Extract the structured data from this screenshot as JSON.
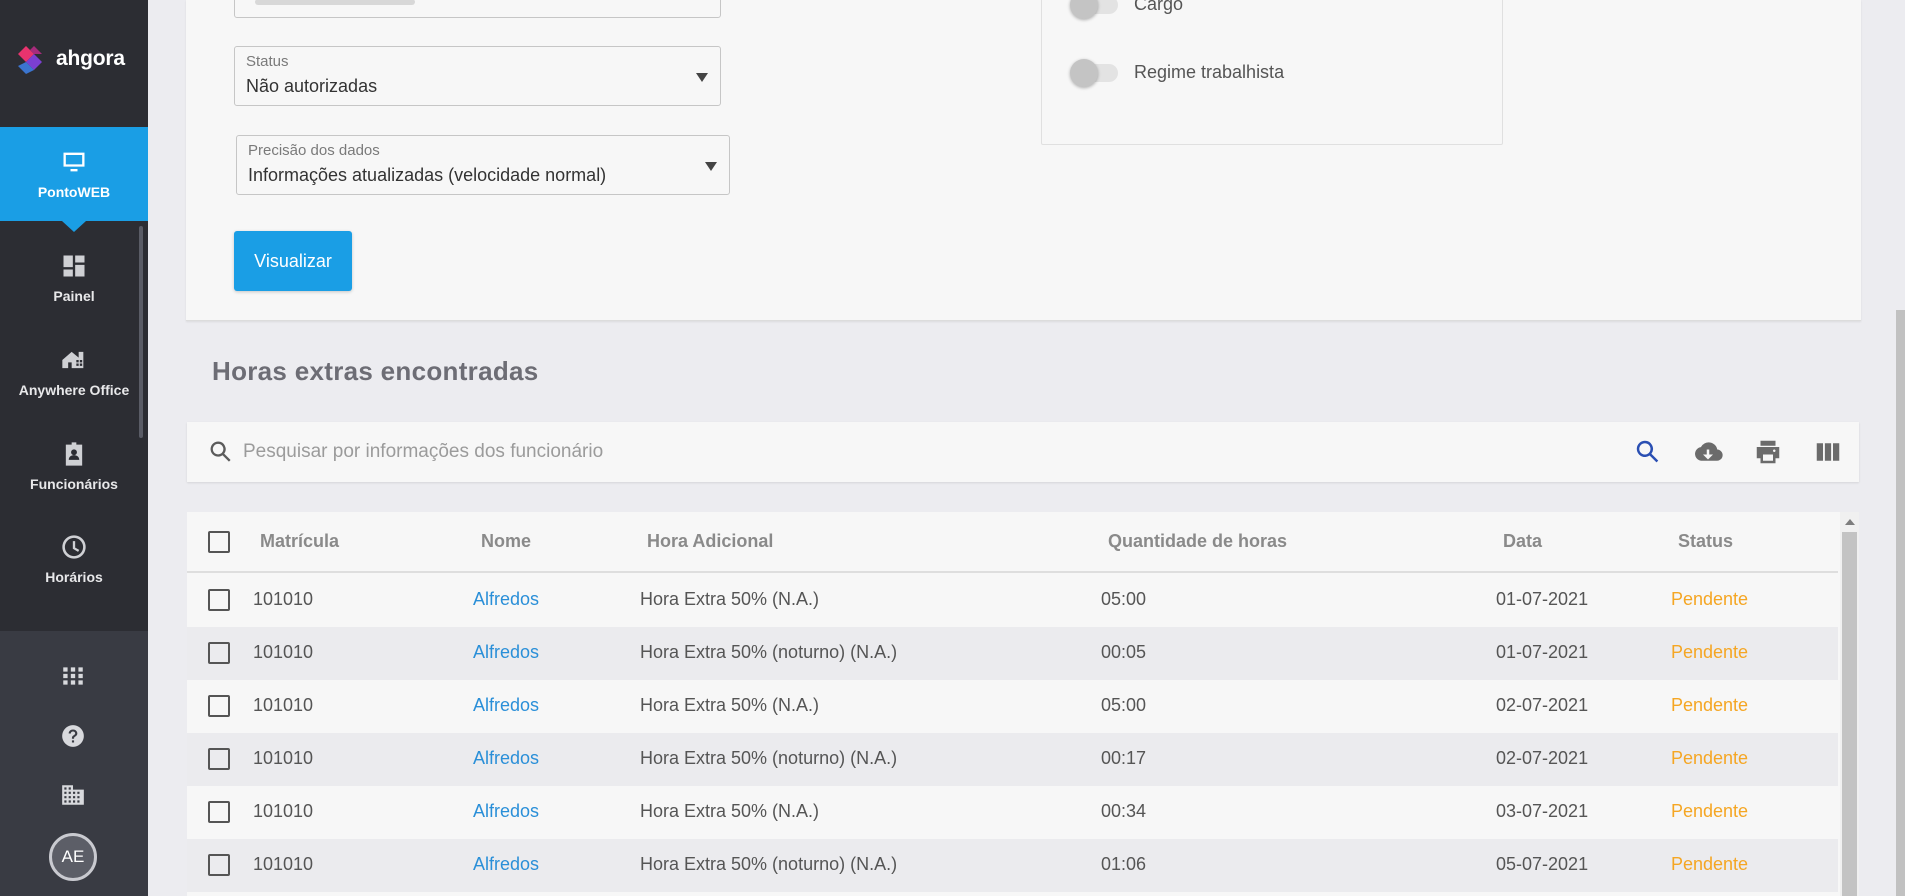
{
  "sidebar": {
    "logo_text": "ahgora",
    "items": [
      {
        "label": "PontoWEB",
        "icon": "monitor-icon"
      },
      {
        "label": "Painel",
        "icon": "dashboard-icon"
      },
      {
        "label": "Anywhere Office",
        "icon": "home-office-icon"
      },
      {
        "label": "Funcionários",
        "icon": "employee-badge-icon"
      },
      {
        "label": "Horários",
        "icon": "clock-icon"
      }
    ],
    "bottom_icons": [
      "apps-grid-icon",
      "help-icon",
      "building-icon"
    ],
    "avatar_initials": "AE"
  },
  "filters": {
    "status": {
      "label": "Status",
      "value": "Não autorizadas"
    },
    "precision": {
      "label": "Precisão dos dados",
      "value": "Informações atualizadas (velocidade normal)"
    },
    "visualizar_label": "Visualizar",
    "toggles": [
      {
        "label": "Cargo",
        "on": false
      },
      {
        "label": "Regime trabalhista",
        "on": false
      }
    ]
  },
  "results": {
    "title": "Horas extras encontradas",
    "search_placeholder": "Pesquisar por informações dos funcionário",
    "toolbar_icons": [
      "search-icon",
      "cloud-download-icon",
      "print-icon",
      "columns-icon"
    ],
    "columns": [
      "Matrícula",
      "Nome",
      "Hora Adicional",
      "Quantidade de horas",
      "Data",
      "Status"
    ],
    "rows": [
      {
        "matricula": "101010",
        "nome": "Alfredos",
        "hora": "Hora Extra 50% (N.A.)",
        "qtd": "05:00",
        "data": "01-07-2021",
        "status": "Pendente"
      },
      {
        "matricula": "101010",
        "nome": "Alfredos",
        "hora": "Hora Extra 50% (noturno) (N.A.)",
        "qtd": "00:05",
        "data": "01-07-2021",
        "status": "Pendente"
      },
      {
        "matricula": "101010",
        "nome": "Alfredos",
        "hora": "Hora Extra 50% (N.A.)",
        "qtd": "05:00",
        "data": "02-07-2021",
        "status": "Pendente"
      },
      {
        "matricula": "101010",
        "nome": "Alfredos",
        "hora": "Hora Extra 50% (noturno) (N.A.)",
        "qtd": "00:17",
        "data": "02-07-2021",
        "status": "Pendente"
      },
      {
        "matricula": "101010",
        "nome": "Alfredos",
        "hora": "Hora Extra 50% (N.A.)",
        "qtd": "00:34",
        "data": "03-07-2021",
        "status": "Pendente"
      },
      {
        "matricula": "101010",
        "nome": "Alfredos",
        "hora": "Hora Extra 50% (noturno) (N.A.)",
        "qtd": "01:06",
        "data": "05-07-2021",
        "status": "Pendente"
      }
    ]
  },
  "colors": {
    "accent": "#1a9ee5",
    "sidebar": "#2c2d33",
    "link": "#2a8fd8",
    "pending": "#f5a623"
  }
}
